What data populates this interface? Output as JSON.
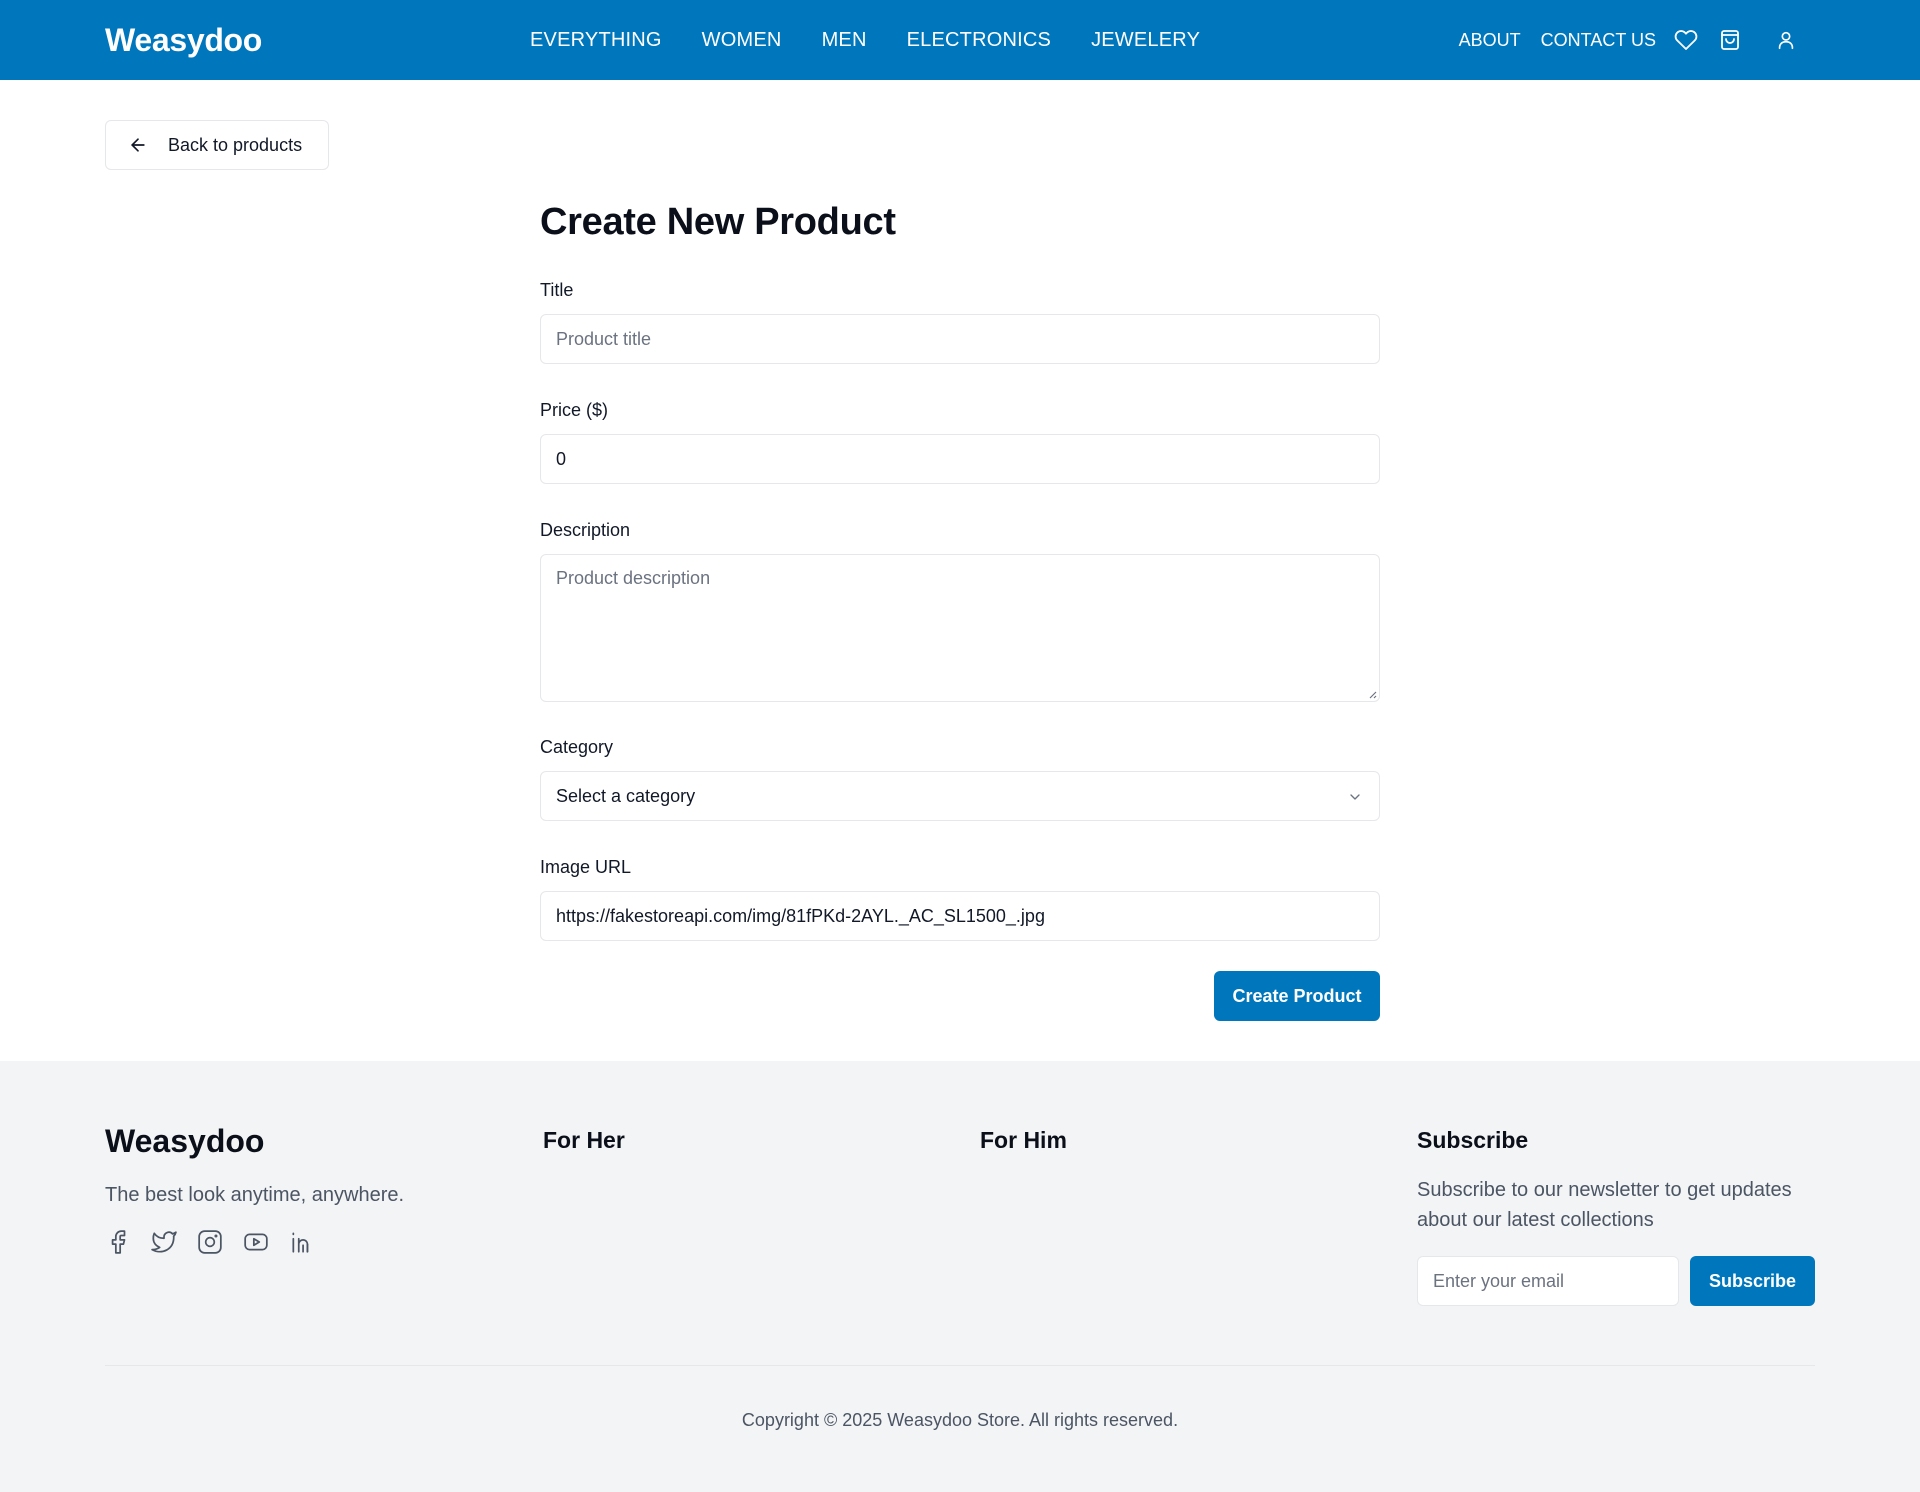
{
  "header": {
    "logo": "Weasydoo",
    "nav": [
      "EVERYTHING",
      "WOMEN",
      "MEN",
      "ELECTRONICS",
      "JEWELERY"
    ],
    "about": "ABOUT",
    "contact": "CONTACT US",
    "icons": [
      "heart-icon",
      "shopping-bag-icon",
      "user-icon"
    ]
  },
  "back_button": {
    "label": "Back to products",
    "icon": "arrow-left-icon"
  },
  "form": {
    "title": "Create New Product",
    "fields": {
      "title": {
        "label": "Title",
        "placeholder": "Product title",
        "value": ""
      },
      "price": {
        "label": "Price ($)",
        "value": "0"
      },
      "description": {
        "label": "Description",
        "placeholder": "Product description",
        "value": ""
      },
      "category": {
        "label": "Category",
        "value": "Select a category"
      },
      "image_url": {
        "label": "Image URL",
        "value": "https://fakestoreapi.com/img/81fPKd-2AYL._AC_SL1500_.jpg"
      }
    },
    "submit": "Create Product"
  },
  "footer": {
    "logo": "Weasydoo",
    "tagline": "The best look anytime, anywhere.",
    "social": [
      "facebook-icon",
      "twitter-icon",
      "instagram-icon",
      "youtube-icon",
      "linkedin-icon"
    ],
    "col_her": "For Her",
    "col_him": "For Him",
    "subscribe": {
      "title": "Subscribe",
      "text": "Subscribe to our newsletter to get updates about our latest collections",
      "placeholder": "Enter your email",
      "button": "Subscribe"
    },
    "copyright": "Copyright © 2025 Weasydoo Store. All rights reserved."
  },
  "colors": {
    "brand": "#0077bd",
    "footer_bg": "#f3f4f6",
    "text": "#111827",
    "muted": "#4b5563",
    "border": "#e5e7eb"
  }
}
